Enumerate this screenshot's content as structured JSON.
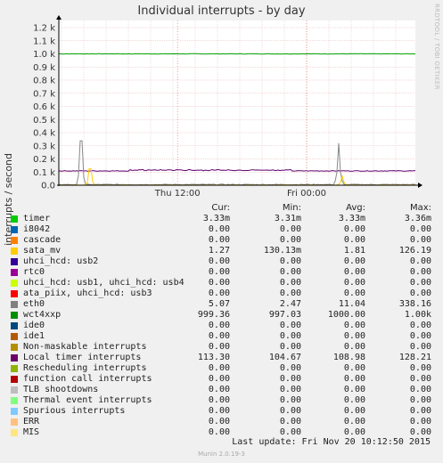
{
  "header": {
    "title": "Individual interrupts - by day",
    "side_credit": "RRDTOOL / TOBI OETIKER"
  },
  "chart_data": {
    "type": "line",
    "title": "Individual interrupts - by day",
    "ylabel": "interrupts / second",
    "ylim": [
      0,
      1200
    ],
    "yticks": [
      0,
      100,
      200,
      300,
      400,
      500,
      600,
      700,
      800,
      900,
      1000,
      1100,
      1200
    ],
    "ytick_labels": [
      "0.0",
      "0.1 k",
      "0.2 k",
      "0.3 k",
      "0.4 k",
      "0.5 k",
      "0.6 k",
      "0.7 k",
      "0.8 k",
      "0.9 k",
      "1.0 k",
      "1.1 k",
      "1.2 k"
    ],
    "x_ticks": [
      {
        "label": "Thu 12:00",
        "pos": 0.333
      },
      {
        "label": "Fri 00:00",
        "pos": 0.695
      }
    ],
    "grid": true,
    "series": [
      {
        "name": "wct4xxp",
        "color": "#00a000",
        "base": 1000,
        "noise": 1.5,
        "spikes": []
      },
      {
        "name": "Local timer interrupts",
        "color": "#5e006e",
        "base": 109,
        "noise": 2.5,
        "bumps": [
          [
            0.2,
            0.65,
            6
          ]
        ],
        "spikes": []
      },
      {
        "name": "eth0",
        "color": "#888888",
        "base": 5,
        "noise": 3,
        "spikes": [
          [
            0.062,
            338
          ],
          [
            0.785,
            320
          ]
        ]
      },
      {
        "name": "sata_mv",
        "color": "#ffcc00",
        "base": 1,
        "noise": 1,
        "spikes": [
          [
            0.088,
            126
          ],
          [
            0.795,
            70
          ]
        ]
      }
    ]
  },
  "legend": {
    "headers": {
      "cur": "Cur:",
      "min": "Min:",
      "avg": "Avg:",
      "max": "Max:"
    },
    "items": [
      {
        "name": "timer",
        "color": "#00cc00",
        "cur": "3.33m",
        "min": "3.31m",
        "avg": "3.33m",
        "max": "3.36m"
      },
      {
        "name": "i8042",
        "color": "#0066b3",
        "cur": "0.00",
        "min": "0.00",
        "avg": "0.00",
        "max": "0.00"
      },
      {
        "name": "cascade",
        "color": "#ff8000",
        "cur": "0.00",
        "min": "0.00",
        "avg": "0.00",
        "max": "0.00"
      },
      {
        "name": "sata_mv",
        "color": "#ffcc00",
        "cur": "1.27",
        "min": "130.13m",
        "avg": "1.81",
        "max": "126.19"
      },
      {
        "name": "uhci_hcd: usb2",
        "color": "#330099",
        "cur": "0.00",
        "min": "0.00",
        "avg": "0.00",
        "max": "0.00"
      },
      {
        "name": "rtc0",
        "color": "#990099",
        "cur": "0.00",
        "min": "0.00",
        "avg": "0.00",
        "max": "0.00"
      },
      {
        "name": "uhci_hcd: usb1, uhci_hcd: usb4",
        "color": "#ccff00",
        "cur": "0.00",
        "min": "0.00",
        "avg": "0.00",
        "max": "0.00"
      },
      {
        "name": "ata_piix, uhci_hcd: usb3",
        "color": "#ff0000",
        "cur": "0.00",
        "min": "0.00",
        "avg": "0.00",
        "max": "0.00"
      },
      {
        "name": "eth0",
        "color": "#808080",
        "cur": "5.07",
        "min": "2.47",
        "avg": "11.04",
        "max": "338.16"
      },
      {
        "name": "wct4xxp",
        "color": "#008f00",
        "cur": "999.36",
        "min": "997.03",
        "avg": "1000.00",
        "max": "1.00k"
      },
      {
        "name": "ide0",
        "color": "#00487d",
        "cur": "0.00",
        "min": "0.00",
        "avg": "0.00",
        "max": "0.00"
      },
      {
        "name": "ide1",
        "color": "#b35a00",
        "cur": "0.00",
        "min": "0.00",
        "avg": "0.00",
        "max": "0.00"
      },
      {
        "name": "Non-maskable interrupts",
        "color": "#b38f00",
        "cur": "0.00",
        "min": "0.00",
        "avg": "0.00",
        "max": "0.00"
      },
      {
        "name": "Local timer interrupts",
        "color": "#6b006b",
        "cur": "113.30",
        "min": "104.67",
        "avg": "108.98",
        "max": "128.21"
      },
      {
        "name": "Rescheduling interrupts",
        "color": "#8fb300",
        "cur": "0.00",
        "min": "0.00",
        "avg": "0.00",
        "max": "0.00"
      },
      {
        "name": "function call interrupts",
        "color": "#b30000",
        "cur": "0.00",
        "min": "0.00",
        "avg": "0.00",
        "max": "0.00"
      },
      {
        "name": "TLB shootdowns",
        "color": "#bebebe",
        "cur": "0.00",
        "min": "0.00",
        "avg": "0.00",
        "max": "0.00"
      },
      {
        "name": "Thermal event interrupts",
        "color": "#80ff80",
        "cur": "0.00",
        "min": "0.00",
        "avg": "0.00",
        "max": "0.00"
      },
      {
        "name": "Spurious interrupts",
        "color": "#80c9ff",
        "cur": "0.00",
        "min": "0.00",
        "avg": "0.00",
        "max": "0.00"
      },
      {
        "name": "ERR",
        "color": "#ffc080",
        "cur": "0.00",
        "min": "0.00",
        "avg": "0.00",
        "max": "0.00"
      },
      {
        "name": "MIS",
        "color": "#ffe680",
        "cur": "0.00",
        "min": "0.00",
        "avg": "0.00",
        "max": "0.00"
      }
    ]
  },
  "last_update": "Last update:  Fri Nov 20 10:12:50 2015",
  "footer": "Munin 2.0.19-3"
}
